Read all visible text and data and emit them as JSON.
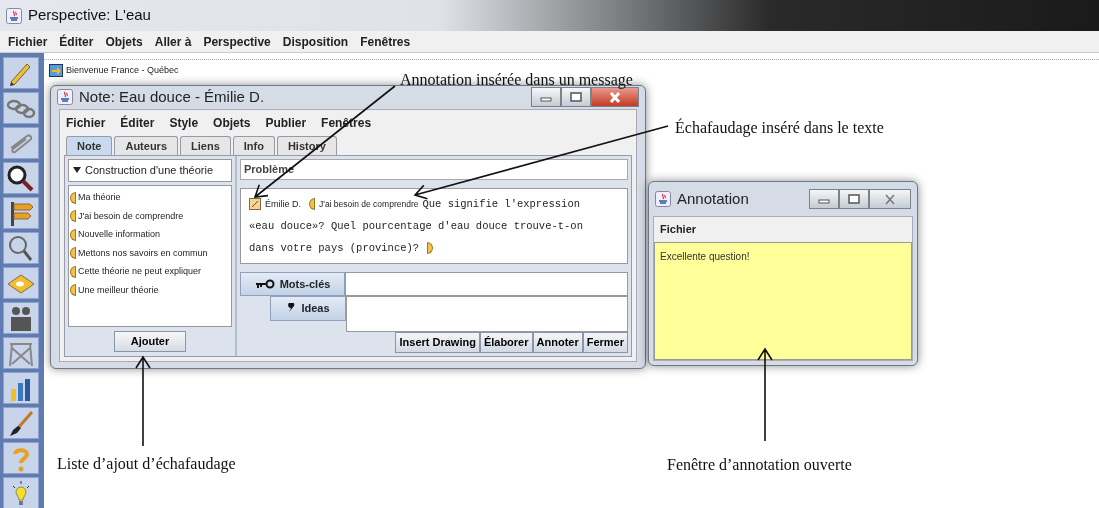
{
  "app_window": {
    "title": "Perspective: L'eau",
    "menu": [
      "Fichier",
      "Éditer",
      "Objets",
      "Aller à",
      "Perspective",
      "Disposition",
      "Fenêtres"
    ]
  },
  "workspace": {
    "view_title": "Bienvenue France - Québec"
  },
  "note_window": {
    "title": "Note: Eau douce - Émilie D.",
    "menu": [
      "Fichier",
      "Éditer",
      "Style",
      "Objets",
      "Publier",
      "Fenêtres"
    ],
    "tabs": [
      {
        "label": "Note",
        "selected": true
      },
      {
        "label": "Auteurs",
        "selected": false
      },
      {
        "label": "Liens",
        "selected": false
      },
      {
        "label": "Info",
        "selected": false
      },
      {
        "label": "History",
        "selected": false
      }
    ],
    "scaffold_list": {
      "title": "Construction d'une théorie",
      "expanded": true,
      "items": [
        "Ma théorie",
        "J'ai besoin de comprendre",
        "Nouvelle information",
        "Mettons nos savoirs en commun",
        "Cette théorie ne peut expliquer",
        "Une meilleur théorie"
      ]
    },
    "add_button": "Ajouter",
    "problem_label": "Problème",
    "note_body": {
      "author": "Émilie D.",
      "scaffold": "J'ai besoin de comprendre",
      "text_lines": [
        "Que signifie l'expression",
        "«eau douce»? Quel pourcentage d'eau douce trouve-t-on",
        "dans votre pays (province)?"
      ]
    },
    "keywords_label": "Mots-clés",
    "ideas_label": "Ideas",
    "buttons": [
      "Insert Drawing",
      "Élaborer",
      "Annoter",
      "Fermer"
    ]
  },
  "annotation_window": {
    "title": "Annotation",
    "menu": [
      "Fichier"
    ],
    "text": "Excellente question!"
  },
  "callouts": [
    {
      "text": "Annotation insérée dans un message"
    },
    {
      "text": "Échafaudage inséré dans le texte"
    },
    {
      "text": "Liste d’ajout d’échafaudage"
    },
    {
      "text": "Fenêtre d’annotation ouverte"
    }
  ]
}
